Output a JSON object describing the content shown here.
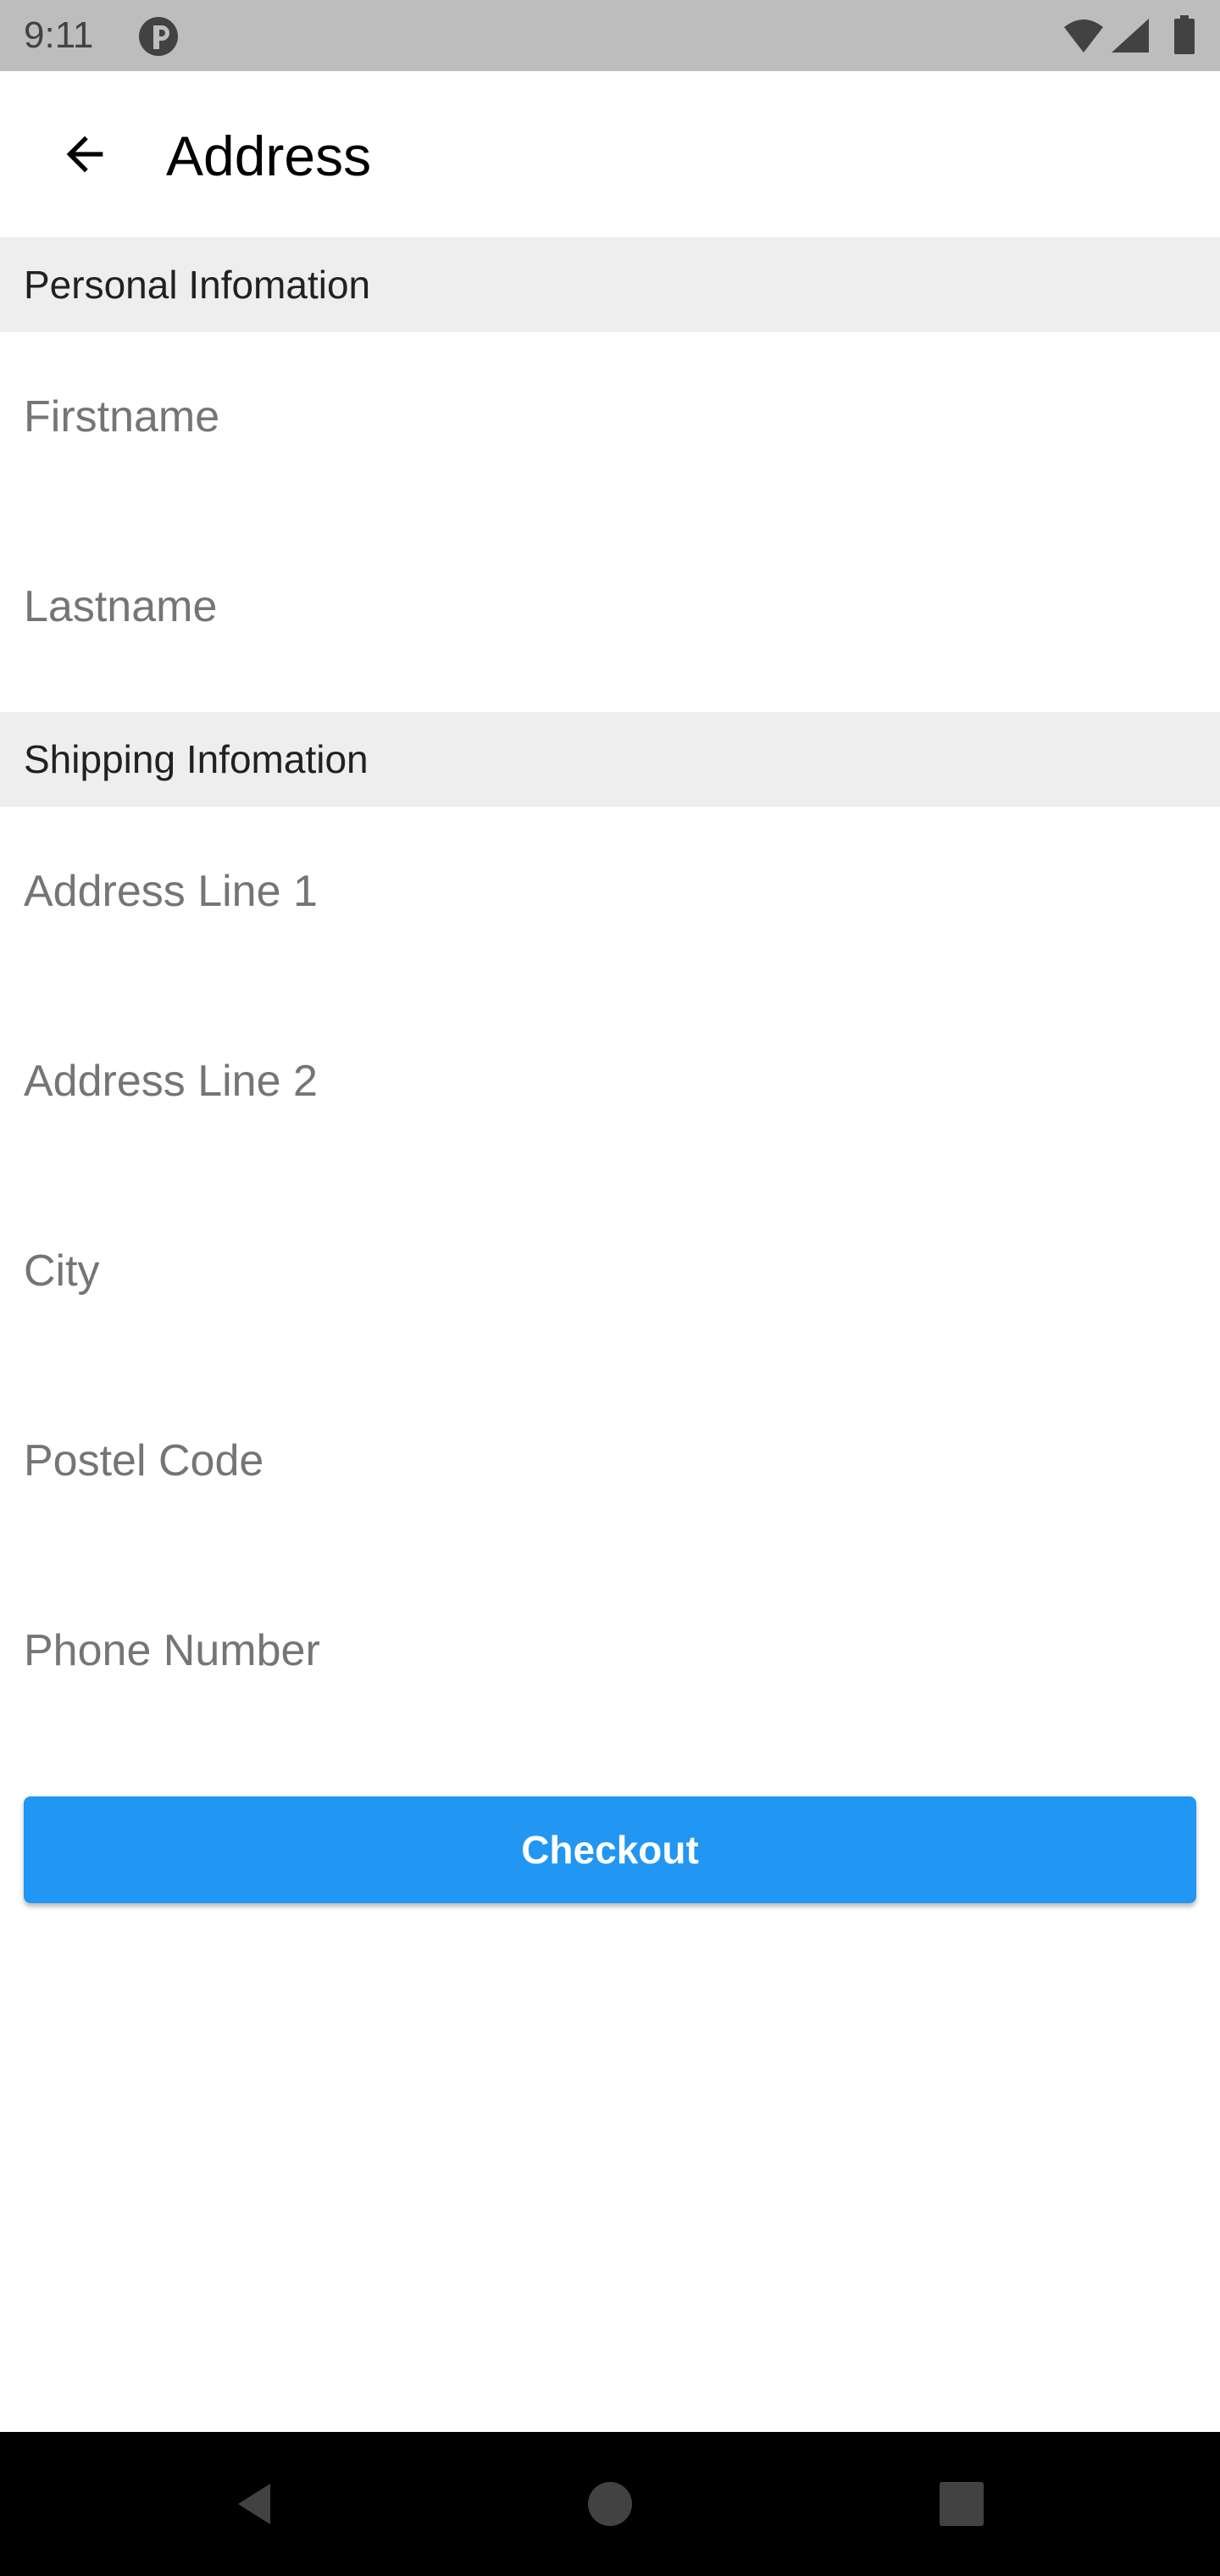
{
  "status_bar": {
    "time": "9:11",
    "icons": [
      "app-notification-icon",
      "wifi-icon",
      "cellular-signal-icon",
      "battery-icon"
    ]
  },
  "app_bar": {
    "back_icon": "arrow-back-icon",
    "title": "Address"
  },
  "sections": {
    "personal": {
      "title": "Personal Infomation",
      "fields": {
        "firstname": {
          "placeholder": "Firstname",
          "value": ""
        },
        "lastname": {
          "placeholder": "Lastname",
          "value": ""
        }
      }
    },
    "shipping": {
      "title": "Shipping Infomation",
      "fields": {
        "address_line_1": {
          "placeholder": "Address Line 1",
          "value": ""
        },
        "address_line_2": {
          "placeholder": "Address Line 2",
          "value": ""
        },
        "city": {
          "placeholder": "City",
          "value": ""
        },
        "postal_code": {
          "placeholder": "Postel Code",
          "value": ""
        },
        "phone_number": {
          "placeholder": "Phone Number",
          "value": ""
        }
      }
    }
  },
  "checkout": {
    "label": "Checkout"
  },
  "nav_bar": {
    "icons": [
      "back-triangle-icon",
      "home-circle-icon",
      "recents-square-icon"
    ]
  },
  "colors": {
    "status_bar": "#bdbdbd",
    "section_header": "#eeeeee",
    "accent": "#2196f3",
    "placeholder": "#757575",
    "nav_bar": "#000000"
  }
}
